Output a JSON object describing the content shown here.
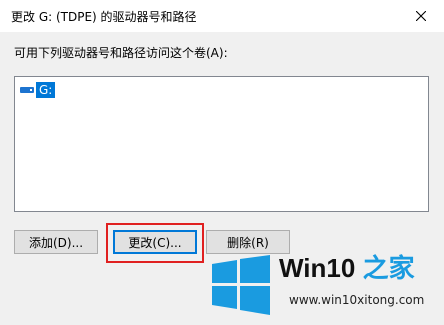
{
  "dialog": {
    "title": "更改 G: (TDPE) 的驱动器号和路径",
    "instruction": "可用下列驱动器号和路径访问这个卷(A):",
    "list_items": [
      {
        "label": "G:",
        "icon": "drive-icon"
      }
    ],
    "buttons": {
      "add": "添加(D)...",
      "change": "更改(C)...",
      "delete": "删除(R)"
    },
    "close_icon": "close-icon"
  },
  "colors": {
    "selection": "#0078d7",
    "highlight_box": "#e02020",
    "brand_blue": "#1a9be0"
  },
  "watermark": {
    "brand_part1": "Win10",
    "brand_part2": " 之家",
    "url": "www.win10xitong.com"
  }
}
